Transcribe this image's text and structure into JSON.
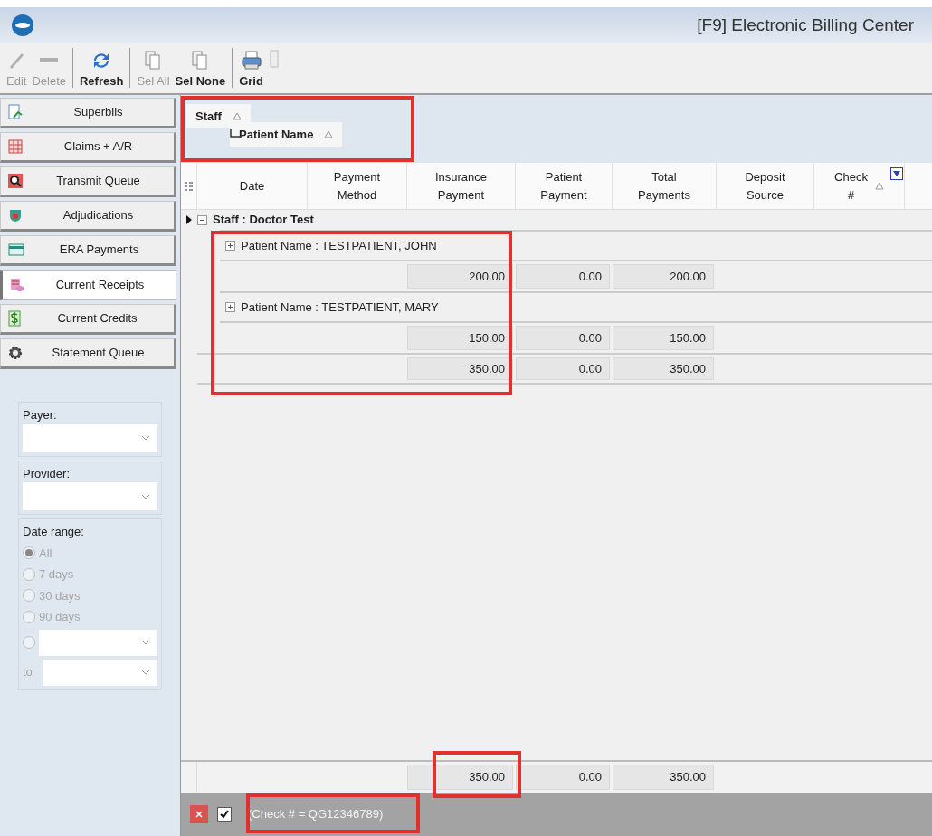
{
  "window": {
    "title": "[F9] Electronic Billing Center"
  },
  "toolbar": [
    {
      "label": "Edit",
      "disabled": true
    },
    {
      "label": "Delete",
      "disabled": true
    },
    {
      "label": "Refresh",
      "disabled": false
    },
    {
      "label": "Sel All",
      "disabled": true
    },
    {
      "label": "Sel None",
      "disabled": false
    },
    {
      "label": "Grid",
      "disabled": false
    }
  ],
  "sidebar": {
    "items": [
      {
        "label": "Superbils",
        "selected": false
      },
      {
        "label": "Claims + A/R",
        "selected": false
      },
      {
        "label": "Transmit Queue",
        "selected": false
      },
      {
        "label": "Adjudications",
        "selected": false
      },
      {
        "label": "ERA Payments",
        "selected": false
      },
      {
        "label": "Current Receipts",
        "selected": true
      },
      {
        "label": "Current Credits",
        "selected": false
      },
      {
        "label": "Statement Queue",
        "selected": false
      }
    ],
    "filters": {
      "payer": {
        "label": "Payer:"
      },
      "provider": {
        "label": "Provider:"
      },
      "date_range": {
        "label": "Date range:",
        "disabled": true,
        "options": [
          {
            "label": "All",
            "selected": true
          },
          {
            "label": "7 days",
            "selected": false
          },
          {
            "label": "30 days",
            "selected": false
          },
          {
            "label": "90 days",
            "selected": false
          }
        ],
        "custom": {
          "selected": false,
          "to_label": "to"
        }
      }
    }
  },
  "group_panel": [
    {
      "label": "Staff",
      "sorted": true
    },
    {
      "label": "Patient Name",
      "sorted": true
    }
  ],
  "grid": {
    "columns": [
      {
        "label": "Date"
      },
      {
        "label": "Payment Method"
      },
      {
        "label": "Insurance Payment"
      },
      {
        "label": "Patient Payment"
      },
      {
        "label": "Total Payments"
      },
      {
        "label": "Deposit Source"
      },
      {
        "label": "Check #",
        "sorted": true
      }
    ],
    "groups": [
      {
        "label": "Staff : Doctor Test",
        "expanded": true,
        "current": true,
        "children": [
          {
            "label": "Patient Name : TESTPATIENT, JOHN",
            "expanded": false,
            "summary": [
              "200.00",
              "0.00",
              "200.00"
            ]
          },
          {
            "label": "Patient Name : TESTPATIENT, MARY",
            "expanded": false,
            "summary": [
              "150.00",
              "0.00",
              "150.00"
            ]
          }
        ],
        "summary": [
          "350.00",
          "0.00",
          "350.00"
        ]
      }
    ],
    "totals": [
      "350.00",
      "0.00",
      "350.00"
    ]
  },
  "filter_bar": {
    "enabled": true,
    "text": "(Check # = QG12346789)"
  }
}
